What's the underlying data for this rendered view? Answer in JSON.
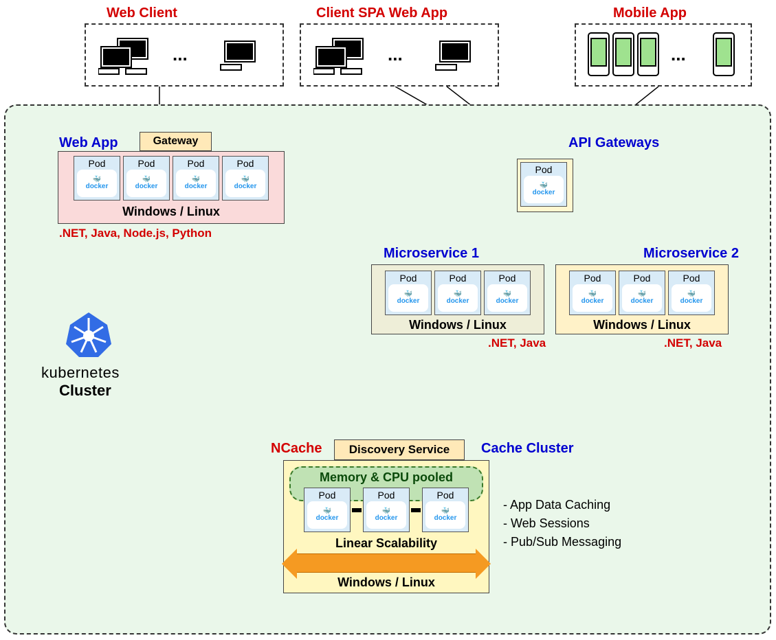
{
  "clients": {
    "web_client_title": "Web Client",
    "spa_title": "Client SPA Web App",
    "mobile_title": "Mobile App",
    "ellipsis": "..."
  },
  "cluster": {
    "k8s_label": "kubernetes",
    "k8s_cluster": "Cluster"
  },
  "webapp": {
    "title": "Web App",
    "gateway_label": "Gateway",
    "os_line": "Windows /   Linux",
    "langs": ".NET, Java, Node.js, Python",
    "pod_label": "Pod",
    "docker_label": "docker"
  },
  "api": {
    "title": "API Gateways",
    "pod_label": "Pod",
    "docker_label": "docker"
  },
  "ms1": {
    "title": "Microservice 1",
    "os_line": "Windows /   Linux",
    "langs": ".NET, Java",
    "pod_label": "Pod",
    "docker_label": "docker"
  },
  "ms2": {
    "title": "Microservice 2",
    "os_line": "Windows /   Linux",
    "langs": ".NET, Java",
    "pod_label": "Pod",
    "docker_label": "docker"
  },
  "ncache": {
    "ncache_label": "NCache",
    "discovery_label": "Discovery Service",
    "cache_cluster_label": "Cache Cluster",
    "pooled_label": "Memory & CPU pooled",
    "linear_label": "Linear Scalability",
    "os_line": "Windows /   Linux",
    "pod_label": "Pod",
    "docker_label": "docker",
    "features": {
      "a": "- App Data Caching",
      "b": "- Web Sessions",
      "c": "- Pub/Sub Messaging"
    }
  }
}
